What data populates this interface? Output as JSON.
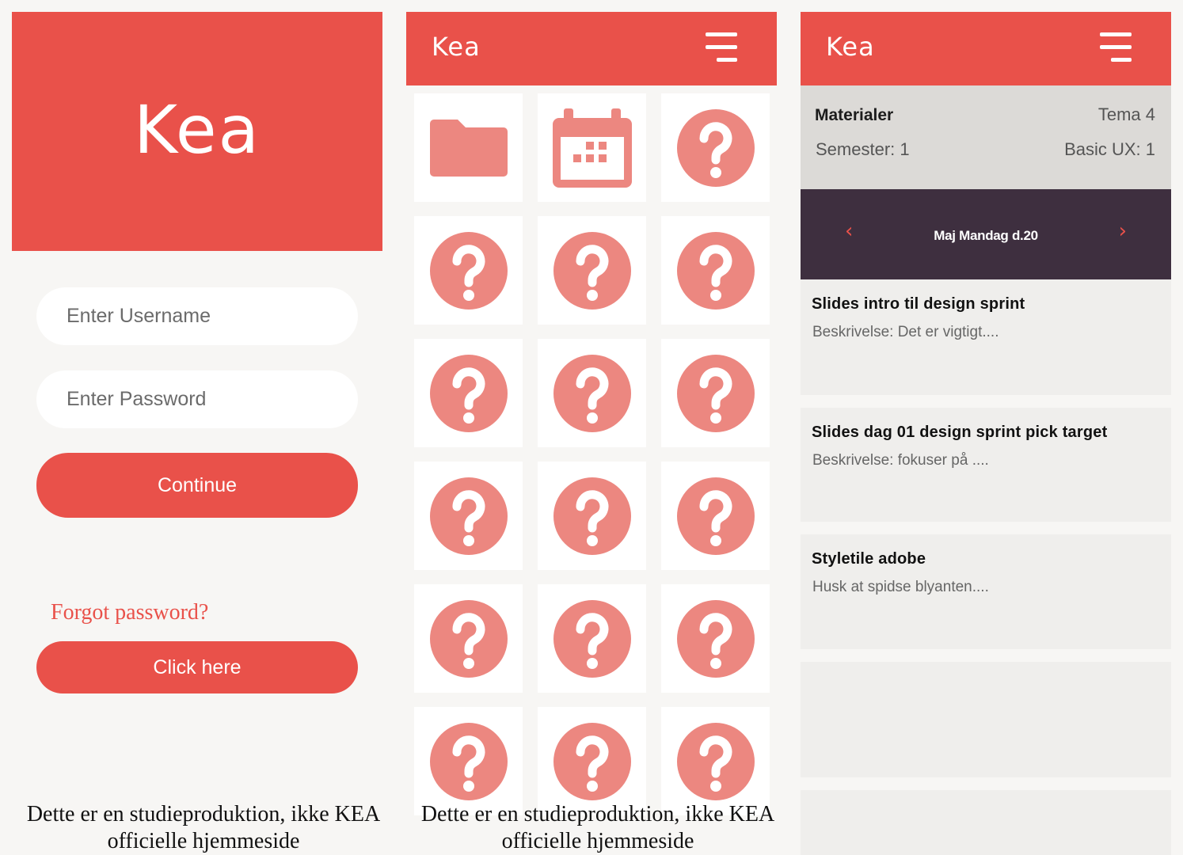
{
  "login": {
    "logo": "Kea",
    "username_placeholder": "Enter Username",
    "password_placeholder": "Enter Password",
    "continue_label": "Continue",
    "forgot_text": "Forgot password?",
    "click_here_label": "Click here",
    "footer_line1": "Dette er en studieproduktion, ikke KEA",
    "footer_line2": "officielle hjemmeside"
  },
  "grid_screen": {
    "logo": "Kea",
    "tiles": [
      "folder-icon",
      "calendar-icon",
      "help-icon",
      "help-icon",
      "help-icon",
      "help-icon",
      "help-icon",
      "help-icon",
      "help-icon",
      "help-icon",
      "help-icon",
      "help-icon",
      "help-icon",
      "help-icon",
      "help-icon",
      "help-icon",
      "help-icon",
      "help-icon"
    ],
    "footer_line1": "Dette er en studieproduktion, ikke KEA",
    "footer_line2": "officielle hjemmeside"
  },
  "materials_screen": {
    "logo": "Kea",
    "title": "Materialer",
    "tema": "Tema 4",
    "semester": "Semester: 1",
    "basic_ux": "Basic UX: 1",
    "date_label": "Maj Mandag d.20",
    "prev_arrow": "‹",
    "next_arrow": "›",
    "items": [
      {
        "title": "Slides intro til design sprint",
        "desc": "Beskrivelse: Det er vigtigt...."
      },
      {
        "title": "Slides dag 01 design sprint pick target",
        "desc": "Beskrivelse: fokuser på ...."
      },
      {
        "title": "Styletile adobe",
        "desc": "Husk at spidse blyanten...."
      }
    ]
  },
  "colors": {
    "brand_red": "#e9514a",
    "icon_pink": "#ec8780",
    "date_bar": "#3e2f3f",
    "info_bar": "#dcdad7"
  }
}
